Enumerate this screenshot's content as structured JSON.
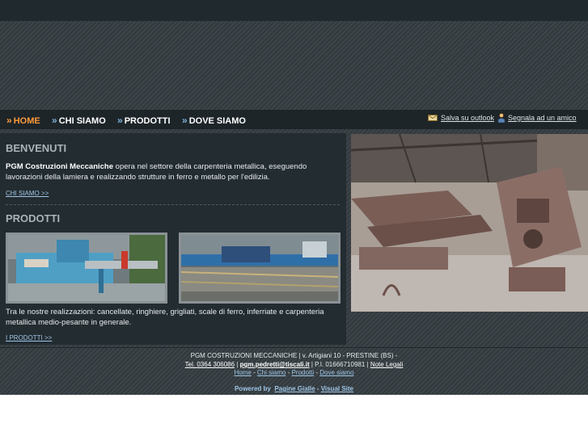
{
  "nav": {
    "items": [
      {
        "label": "HOME",
        "active": true
      },
      {
        "label": "CHI SIAMO",
        "active": false
      },
      {
        "label": "PRODOTTI",
        "active": false
      },
      {
        "label": "DOVE SIAMO",
        "active": false
      }
    ],
    "arrow": "»"
  },
  "utility": {
    "outlook_label": "Salva su outlook",
    "recommend_label": "Segnala ad un amico"
  },
  "welcome": {
    "heading": "BENVENUTI",
    "company": "PGM Costruzioni Meccaniche",
    "text": " opera nel settore della carpenteria metallica, eseguendo lavorazioni della lamiera e realizzando strutture in ferro e metallo per l'edilizia.",
    "link": "CHI SIAMO >>"
  },
  "products": {
    "heading": "PRODOTTI",
    "text": "Tra le nostre realizzazioni: cancellate, ringhiere, grigliati, scale di ferro, inferriate e carpenteria metallica medio-pesante in generale.",
    "link": "I PRODOTTI >>"
  },
  "footer": {
    "company": "PGM COSTRUZIONI MECCANICHE | v. Artigiani 10 - PRESTINE (BS) -",
    "tel": "Tel. 0364 306086",
    "sep1": " | ",
    "email": "pgm.pedretti@tiscali.it",
    "piva": " | P.I. 01666710981 | ",
    "legal": "Note Legali",
    "links": [
      "Home",
      "Chi siamo",
      "Prodotti",
      "Dove siamo"
    ],
    "link_sep": " - ",
    "powered": "Powered by",
    "pagine_gialle": "Pagine Gialle",
    "dash": " - ",
    "visual_site": "Visual Site"
  },
  "colors": {
    "accent_active": "#ff9a3a",
    "link": "#9fc6e6",
    "panel": "#232c31",
    "background": "#353d42"
  },
  "icons": [
    "outlook-icon",
    "recommend-icon"
  ]
}
